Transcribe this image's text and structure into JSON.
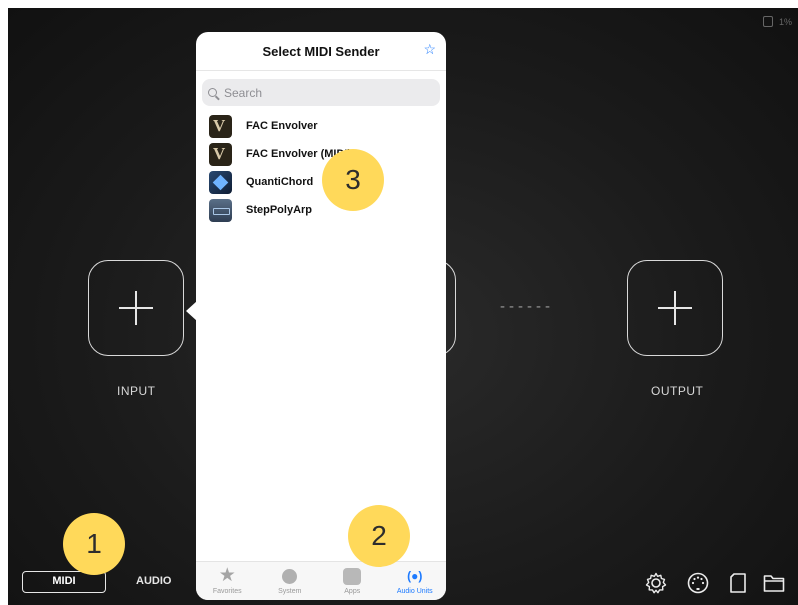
{
  "status": {
    "battery": "1%"
  },
  "slots": {
    "input_label": "INPUT",
    "output_label": "OUTPUT",
    "connector": "------"
  },
  "popover": {
    "title": "Select MIDI Sender",
    "search_placeholder": "Search",
    "items": [
      {
        "name": "FAC Envolver",
        "icon": "fac-envolver-icon"
      },
      {
        "name": "FAC Envolver (MIDI)",
        "icon": "fac-envolver-icon"
      },
      {
        "name": "QuantiChord",
        "icon": "quantichord-icon"
      },
      {
        "name": "StepPolyArp",
        "icon": "steppolyarp-icon"
      }
    ],
    "tabs": [
      {
        "label": "Favorites",
        "icon": "star-icon"
      },
      {
        "label": "System",
        "icon": "gear-icon"
      },
      {
        "label": "Apps",
        "icon": "app-icon"
      },
      {
        "label": "Audio Units",
        "icon": "audio-units-icon",
        "active": true
      }
    ]
  },
  "bottom": {
    "midi_label": "MIDI",
    "audio_label": "AUDIO",
    "icons": [
      "settings-gear-icon",
      "midi-port-icon",
      "page-icon",
      "folder-icon"
    ]
  },
  "callouts": [
    "1",
    "2",
    "3"
  ],
  "colors": {
    "accent": "#1e7bff",
    "callout": "#ffd95a",
    "background": "#1b1b1b"
  }
}
